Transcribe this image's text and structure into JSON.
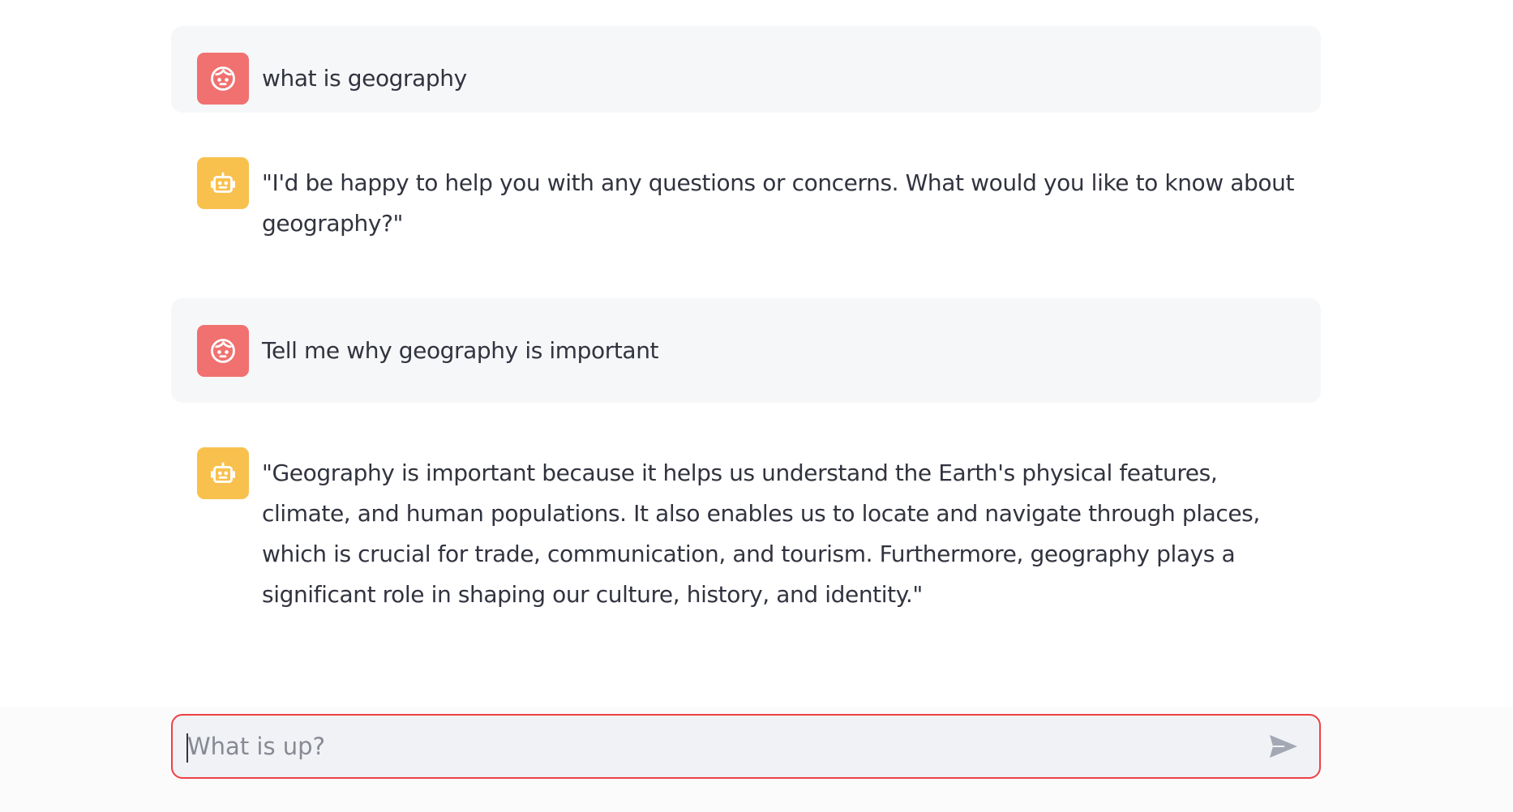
{
  "colors": {
    "user_avatar": "#f0716f",
    "assistant_avatar": "#f8c14e",
    "user_bubble": "#f6f7f9",
    "input_border": "#ef4043",
    "input_bg": "#f0f2f6",
    "send_icon": "#a3a8b4"
  },
  "messages": [
    {
      "role": "user",
      "avatar_icon": "face-icon",
      "text": "what is geography"
    },
    {
      "role": "assistant",
      "avatar_icon": "robot-icon",
      "text": "\"I'd be happy to help you with any questions or concerns. What would you like to know about geography?\""
    },
    {
      "role": "user",
      "avatar_icon": "face-icon",
      "text": "Tell me why geography is important"
    },
    {
      "role": "assistant",
      "avatar_icon": "robot-icon",
      "text": "\"Geography is important because it helps us understand the Earth's physical features, climate, and human populations. It also enables us to locate and navigate through places, which is crucial for trade, communication, and tourism. Furthermore, geography plays a significant role in shaping our culture, history, and identity.\""
    }
  ],
  "chat_input": {
    "placeholder": "What is up?",
    "value": "",
    "send_icon": "send-icon"
  }
}
